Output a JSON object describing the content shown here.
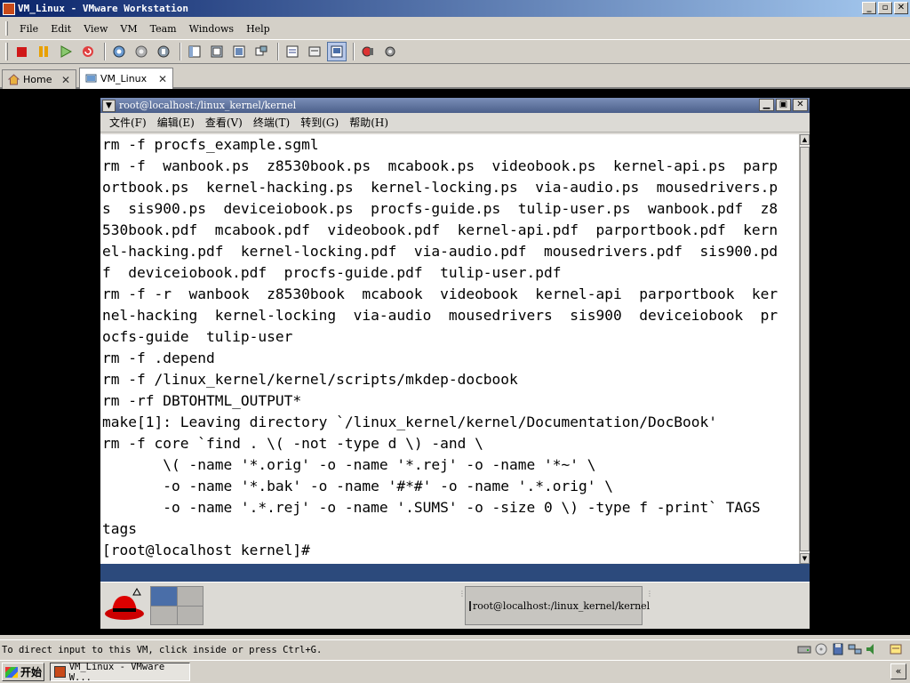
{
  "vm_window": {
    "title": "VM_Linux - VMware Workstation",
    "buttons": {
      "minimize": "_",
      "maximize": "▫",
      "close": "✕"
    }
  },
  "menubar": [
    "File",
    "Edit",
    "View",
    "VM",
    "Team",
    "Windows",
    "Help"
  ],
  "toolbar": {
    "buttons": [
      "power-off",
      "suspend",
      "power-on",
      "reset",
      "snapshot",
      "revert-snapshot",
      "snapshot-manager",
      "quick-switch",
      "full-screen",
      "fit-guest",
      "unity",
      "summary",
      "console",
      "appliance-view",
      "capture-movie",
      "preferences"
    ]
  },
  "tabs": [
    {
      "label": "Home",
      "close": "✕",
      "active": false
    },
    {
      "label": "VM_Linux",
      "close": "✕",
      "active": true
    }
  ],
  "guest_terminal": {
    "title": "root@localhost:/linux_kernel/kernel",
    "menu": [
      "文件(F)",
      "编辑(E)",
      "查看(V)",
      "终端(T)",
      "转到(G)",
      "帮助(H)"
    ],
    "lines": [
      "rm -f procfs_example.sgml",
      "rm -f  wanbook.ps  z8530book.ps  mcabook.ps  videobook.ps  kernel-api.ps  parp",
      "ortbook.ps  kernel-hacking.ps  kernel-locking.ps  via-audio.ps  mousedrivers.p",
      "s  sis900.ps  deviceiobook.ps  procfs-guide.ps  tulip-user.ps  wanbook.pdf  z8",
      "530book.pdf  mcabook.pdf  videobook.pdf  kernel-api.pdf  parportbook.pdf  kern",
      "el-hacking.pdf  kernel-locking.pdf  via-audio.pdf  mousedrivers.pdf  sis900.pd",
      "f  deviceiobook.pdf  procfs-guide.pdf  tulip-user.pdf",
      "rm -f -r  wanbook  z8530book  mcabook  videobook  kernel-api  parportbook  ker",
      "nel-hacking  kernel-locking  via-audio  mousedrivers  sis900  deviceiobook  pr",
      "ocfs-guide  tulip-user",
      "rm -f .depend",
      "rm -f /linux_kernel/kernel/scripts/mkdep-docbook",
      "rm -rf DBTOHTML_OUTPUT*",
      "make[1]: Leaving directory `/linux_kernel/kernel/Documentation/DocBook'",
      "rm -f core `find . \\( -not -type d \\) -and \\",
      "       \\( -name '*.orig' -o -name '*.rej' -o -name '*~' \\",
      "       -o -name '*.bak' -o -name '#*#' -o -name '.*.orig' \\",
      "       -o -name '.*.rej' -o -name '.SUMS' -o -size 0 \\) -type f -print` TAGS",
      "tags",
      "[root@localhost kernel]#"
    ],
    "panel_task_label": "root@localhost:/linux_kernel/kernel"
  },
  "statusbar": {
    "text": "To direct input to this VM, click inside or press Ctrl+G."
  },
  "taskbar": {
    "start_label": "开始",
    "task_label": "VM_Linux - VMware W...",
    "tray_chevron": "«"
  },
  "colors": {
    "title_gradient_start": "#0a246a",
    "title_gradient_end": "#a6caf0",
    "guest_title_bar": "#5a6e98",
    "guest_panel_strip": "#2c4a7c",
    "terminal_bg": "#ffffff"
  }
}
